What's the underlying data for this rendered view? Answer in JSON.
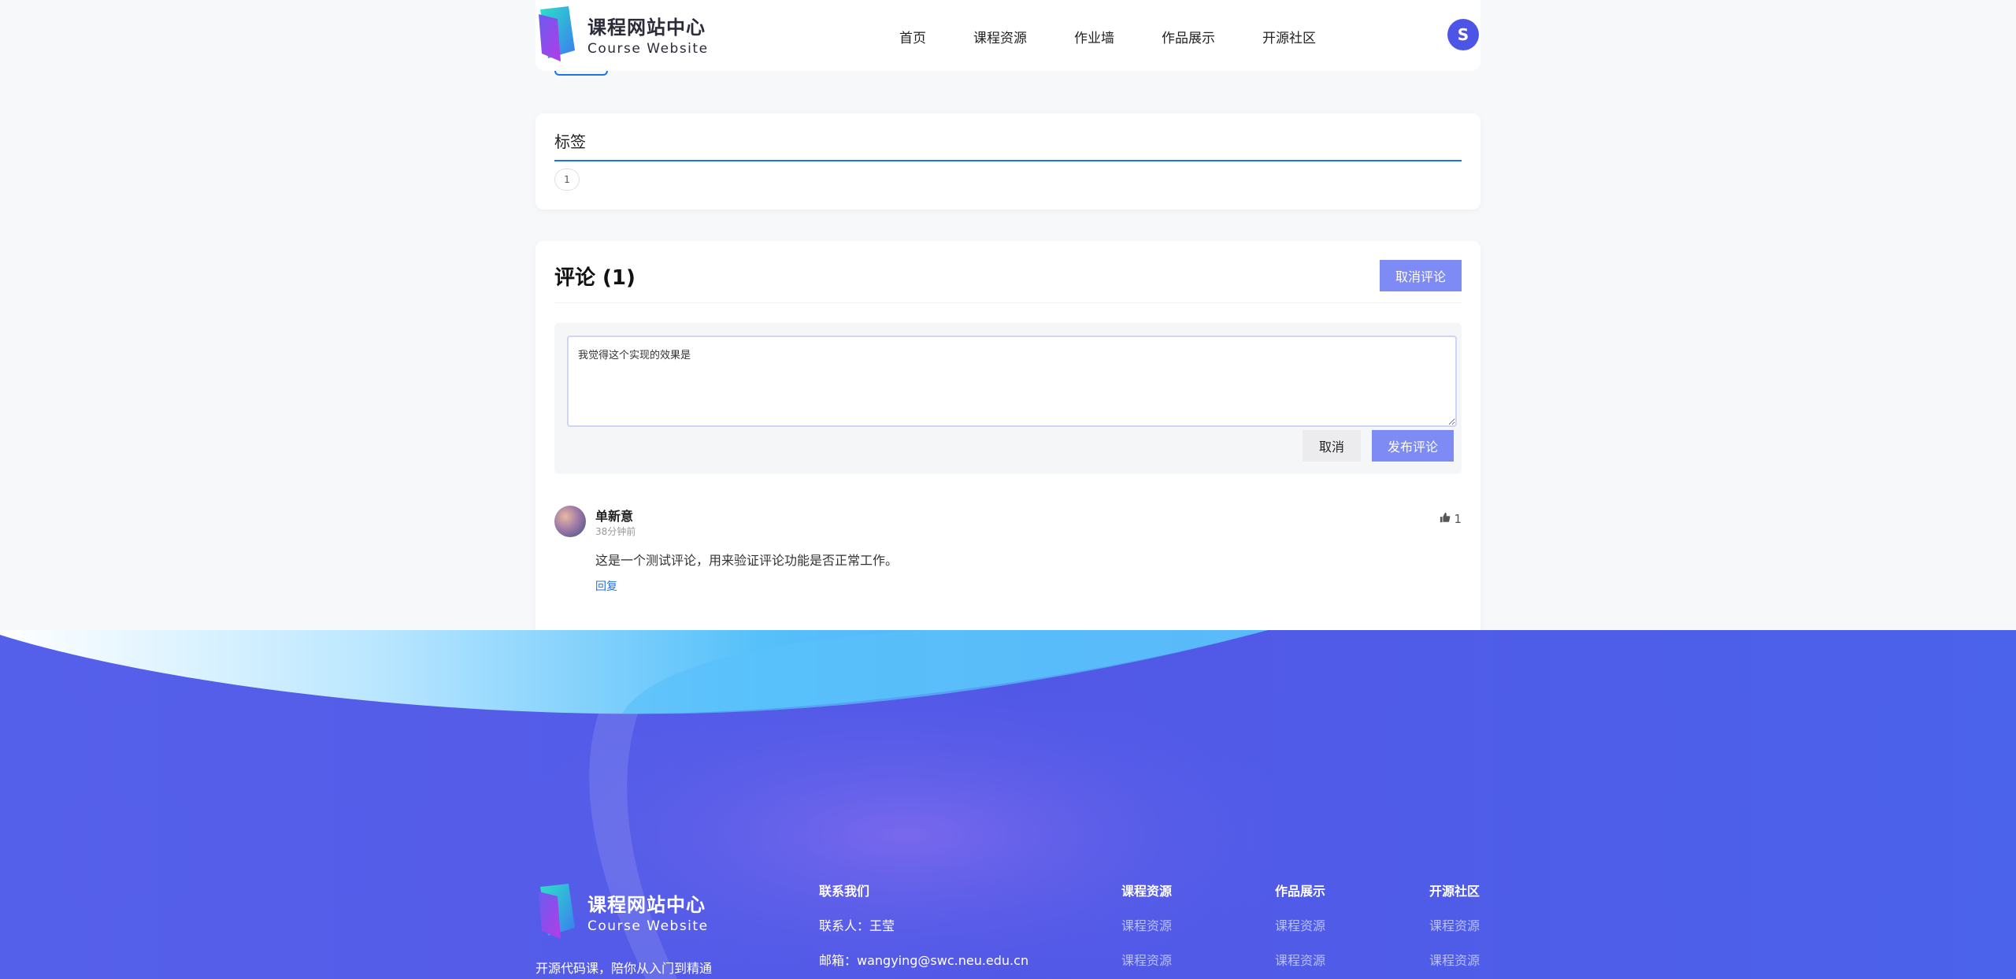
{
  "header": {
    "logo_cn": "课程网站中心",
    "logo_en": "Course Website",
    "nav": [
      "首页",
      "课程资源",
      "作业墙",
      "作品展示",
      "开源社区"
    ],
    "avatar_letter": "S"
  },
  "tags": {
    "title": "标签",
    "items": [
      "1"
    ]
  },
  "comments": {
    "title": "评论 (1)",
    "cancel_comment_label": "取消评论",
    "draft_text": "我觉得这个实现的效果是",
    "cancel_label": "取消",
    "submit_label": "发布评论",
    "items": [
      {
        "user": "单新意",
        "time": "38分钟前",
        "body": "这是一个测试评论，用来验证评论功能是否正常工作。",
        "likes": "1",
        "reply_label": "回复"
      }
    ]
  },
  "footer": {
    "logo_cn": "课程网站中心",
    "logo_en": "Course Website",
    "slogan": "开源代码课，陪你从入门到精通",
    "contact": {
      "title": "联系我们",
      "person": "联系人：王莹",
      "email": "邮箱：wangying@swc.neu.edu.cn"
    },
    "columns": [
      {
        "title": "课程资源",
        "links": [
          "课程资源",
          "课程资源"
        ]
      },
      {
        "title": "作品展示",
        "links": [
          "课程资源",
          "课程资源"
        ]
      },
      {
        "title": "开源社区",
        "links": [
          "课程资源",
          "课程资源"
        ]
      }
    ]
  },
  "colors": {
    "accent": "#1e73e8",
    "button": "#7f8bf5",
    "footer_bg": "#4c5fe8",
    "wave_light": "#5bc2fb"
  }
}
